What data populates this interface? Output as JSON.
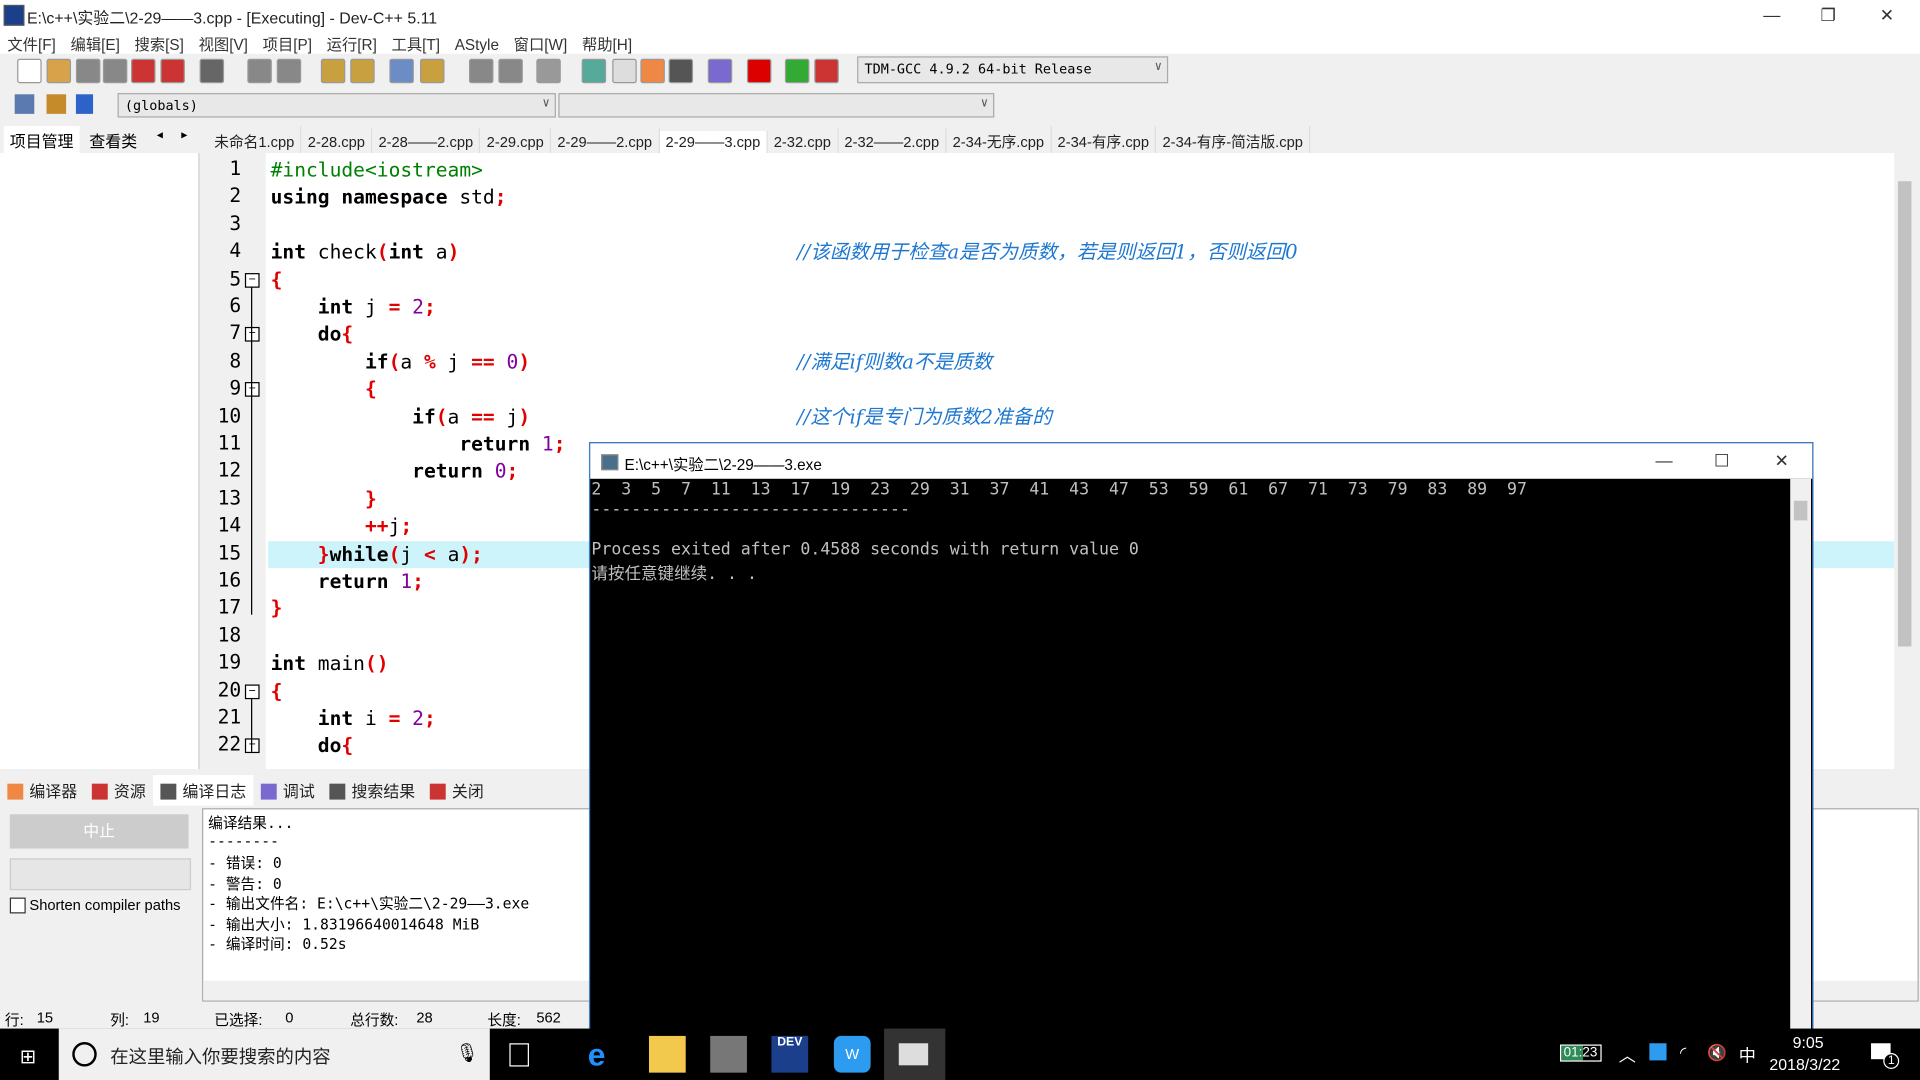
{
  "window": {
    "title": "E:\\c++\\实验二\\2-29——3.cpp - [Executing] - Dev-C++ 5.11"
  },
  "menu": [
    "文件[F]",
    "编辑[E]",
    "搜索[S]",
    "视图[V]",
    "项目[P]",
    "运行[R]",
    "工具[T]",
    "AStyle",
    "窗口[W]",
    "帮助[H]"
  ],
  "toolbar": {
    "compiler": "TDM-GCC 4.9.2 64-bit Release",
    "scope": "(globals)"
  },
  "panel_tabs": [
    "项目管理",
    "查看类"
  ],
  "file_tabs": [
    "未命名1.cpp",
    "2-28.cpp",
    "2-28——2.cpp",
    "2-29.cpp",
    "2-29——2.cpp",
    "2-29——3.cpp",
    "2-32.cpp",
    "2-32——2.cpp",
    "2-34-无序.cpp",
    "2-34-有序.cpp",
    "2-34-有序-简洁版.cpp"
  ],
  "active_tab": 5,
  "code": {
    "highlight_line": 15,
    "fold_lines": [
      5,
      7,
      9,
      20,
      22
    ],
    "lines": [
      [
        [
          "p",
          "#include<iostream>"
        ]
      ],
      [
        [
          "k",
          "using namespace "
        ],
        [
          "i",
          "std"
        ],
        [
          "s",
          ";"
        ]
      ],
      [],
      [
        [
          "k",
          "int "
        ],
        [
          "i",
          "check"
        ],
        [
          "s",
          "("
        ],
        [
          "k",
          "int "
        ],
        [
          "i",
          "a"
        ],
        [
          "s",
          ")"
        ]
      ],
      [
        [
          "s",
          "{"
        ]
      ],
      [
        [
          "k",
          "    int "
        ],
        [
          "i",
          "j "
        ],
        [
          "s",
          "= "
        ],
        [
          "n",
          "2"
        ],
        [
          "s",
          ";"
        ]
      ],
      [
        [
          "k",
          "    do"
        ],
        [
          "s",
          "{"
        ]
      ],
      [
        [
          "k",
          "        if"
        ],
        [
          "s",
          "("
        ],
        [
          "i",
          "a "
        ],
        [
          "s",
          "% "
        ],
        [
          "i",
          "j "
        ],
        [
          "s",
          "== "
        ],
        [
          "n",
          "0"
        ],
        [
          "s",
          ")"
        ]
      ],
      [
        [
          "s",
          "        {"
        ]
      ],
      [
        [
          "k",
          "            if"
        ],
        [
          "s",
          "("
        ],
        [
          "i",
          "a "
        ],
        [
          "s",
          "== "
        ],
        [
          "i",
          "j"
        ],
        [
          "s",
          ")"
        ]
      ],
      [
        [
          "k",
          "                return "
        ],
        [
          "n",
          "1"
        ],
        [
          "s",
          ";"
        ]
      ],
      [
        [
          "k",
          "            return "
        ],
        [
          "n",
          "0"
        ],
        [
          "s",
          ";"
        ]
      ],
      [
        [
          "s",
          "        }"
        ]
      ],
      [
        [
          "s",
          "        ++"
        ],
        [
          "i",
          "j"
        ],
        [
          "s",
          ";"
        ]
      ],
      [
        [
          "s",
          "    }"
        ],
        [
          "k",
          "while"
        ],
        [
          "s",
          "("
        ],
        [
          "i",
          "j "
        ],
        [
          "s",
          "< "
        ],
        [
          "i",
          "a"
        ],
        [
          "s",
          ");"
        ]
      ],
      [
        [
          "k",
          "    return "
        ],
        [
          "n",
          "1"
        ],
        [
          "s",
          ";"
        ]
      ],
      [
        [
          "s",
          "}"
        ]
      ],
      [],
      [
        [
          "k",
          "int "
        ],
        [
          "i",
          "main"
        ],
        [
          "s",
          "()"
        ]
      ],
      [
        [
          "s",
          "{"
        ]
      ],
      [
        [
          "k",
          "    int "
        ],
        [
          "i",
          "i "
        ],
        [
          "s",
          "= "
        ],
        [
          "n",
          "2"
        ],
        [
          "s",
          ";"
        ]
      ],
      [
        [
          "k",
          "    do"
        ],
        [
          "s",
          "{"
        ]
      ]
    ],
    "comments": {
      "4": "//该函数用于检查a是否为质数，若是则返回1，否则返回0",
      "8": "//满足if则数a不是质数",
      "10": "//这个if是专门为质数2准备的"
    }
  },
  "bottom_tabs": [
    "编译器",
    "资源",
    "编译日志",
    "调试",
    "搜索结果",
    "关闭"
  ],
  "log": {
    "abort_label": "中止",
    "shorten_label": "Shorten compiler paths",
    "lines": [
      "编译结果...",
      "--------",
      "- 错误: 0",
      "- 警告: 0",
      "- 输出文件名: E:\\c++\\实验二\\2-29——3.exe",
      "- 输出大小: 1.83196640014648 MiB",
      "- 编译时间: 0.52s"
    ]
  },
  "status": {
    "row_label": "行:",
    "row": "15",
    "col_label": "列:",
    "col": "19",
    "sel_label": "已选择:",
    "sel": "0",
    "total_label": "总行数:",
    "total": "28",
    "len_label": "长度:",
    "len": "562"
  },
  "console": {
    "title": "E:\\c++\\实验二\\2-29——3.exe",
    "lines": [
      "2  3  5  7  11  13  17  19  23  29  31  37  41  43  47  53  59  61  67  71  73  79  83  89  97",
      "--------------------------------",
      "Process exited after 0.4588 seconds with return value 0",
      "请按任意键继续. . ."
    ]
  },
  "taskbar": {
    "search_placeholder": "在这里输入你要搜索的内容",
    "battery": "01:23",
    "ime": "中",
    "time": "9:05",
    "date": "2018/3/22",
    "notifications": "1"
  },
  "colors": {
    "keyword": "#000000",
    "symbol": "#e00000",
    "number": "#8000a0",
    "preprocessor": "#008000",
    "comment": "#1e78d0",
    "current_line": "#cdf3fb"
  }
}
